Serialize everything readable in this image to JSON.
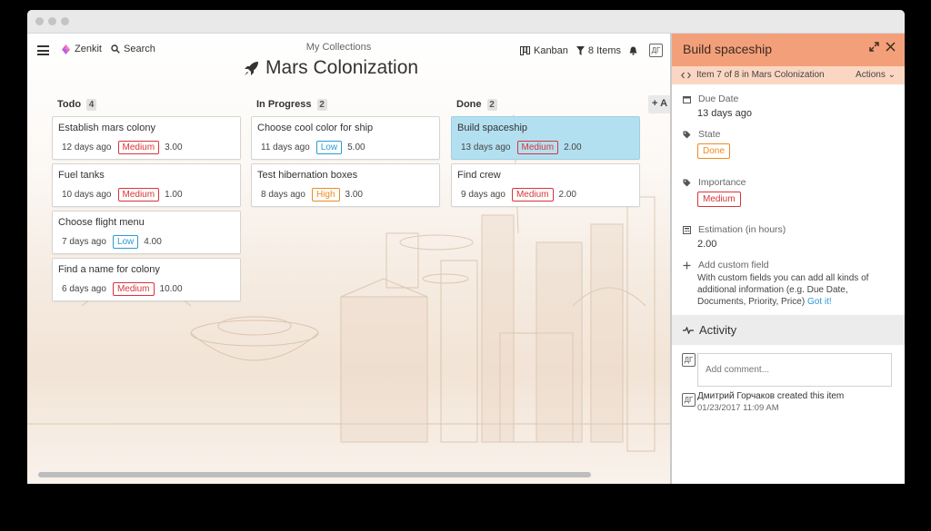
{
  "app": {
    "name": "Zenkit",
    "search_label": "Search",
    "breadcrumb": "My Collections",
    "title": "Mars Colonization"
  },
  "toolbar": {
    "view_label": "Kanban",
    "filter_label": "8 Items",
    "user_initials": "ДГ"
  },
  "add_column_label": "+ A",
  "columns": [
    {
      "name": "Todo",
      "count": "4",
      "cards": [
        {
          "title": "Establish mars colony",
          "ago": "12 days ago",
          "tag": "Medium",
          "estimate": "3.00"
        },
        {
          "title": "Fuel tanks",
          "ago": "10 days ago",
          "tag": "Medium",
          "estimate": "1.00"
        },
        {
          "title": "Choose flight menu",
          "ago": "7 days ago",
          "tag": "Low",
          "estimate": "4.00"
        },
        {
          "title": "Find a name for colony",
          "ago": "6 days ago",
          "tag": "Medium",
          "estimate": "10.00"
        }
      ]
    },
    {
      "name": "In Progress",
      "count": "2",
      "cards": [
        {
          "title": "Choose cool color for ship",
          "ago": "11 days ago",
          "tag": "Low",
          "estimate": "5.00"
        },
        {
          "title": "Test hibernation boxes",
          "ago": "8 days ago",
          "tag": "High",
          "estimate": "3.00"
        }
      ]
    },
    {
      "name": "Done",
      "count": "2",
      "cards": [
        {
          "title": "Build spaceship",
          "ago": "13 days ago",
          "tag": "Medium",
          "estimate": "2.00"
        },
        {
          "title": "Find crew",
          "ago": "9 days ago",
          "tag": "Medium",
          "estimate": "2.00"
        }
      ]
    }
  ],
  "panel": {
    "title": "Build spaceship",
    "subtitle": "Item 7 of 8 in Mars Colonization",
    "actions_label": "Actions ⌄",
    "due_date_label": "Due Date",
    "due_date_value": "13 days ago",
    "state_label": "State",
    "state_value": "Done",
    "importance_label": "Importance",
    "importance_value": "Medium",
    "estimation_label": "Estimation (in hours)",
    "estimation_value": "2.00",
    "custom_field_label": "Add custom field",
    "custom_field_desc": "With custom fields you can add all kinds of additional information (e.g. Due Date, Documents, Priority, Price)",
    "got_it_label": "Got it!",
    "activity_label": "Activity",
    "comment_placeholder": "Add comment...",
    "log_text": "Дмитрий Горчаков created this item",
    "log_time": "01/23/2017 11:09 AM"
  },
  "colors": {
    "accent": "#f3a07a",
    "accent_light": "#fbd6c2",
    "selected_card": "#b3e0f0",
    "medium": "#d8343a",
    "low": "#2a9bd5",
    "high": "#ef8a20"
  },
  "icons": [
    "menu-icon",
    "zenkit-logo-icon",
    "search-icon",
    "rocket-icon",
    "kanban-icon",
    "filter-icon",
    "bell-icon",
    "expand-icon",
    "close-icon",
    "code-nav-icon",
    "calendar-icon",
    "tag-icon",
    "calculator-icon",
    "plus-icon",
    "activity-icon",
    "avatar-icon"
  ]
}
